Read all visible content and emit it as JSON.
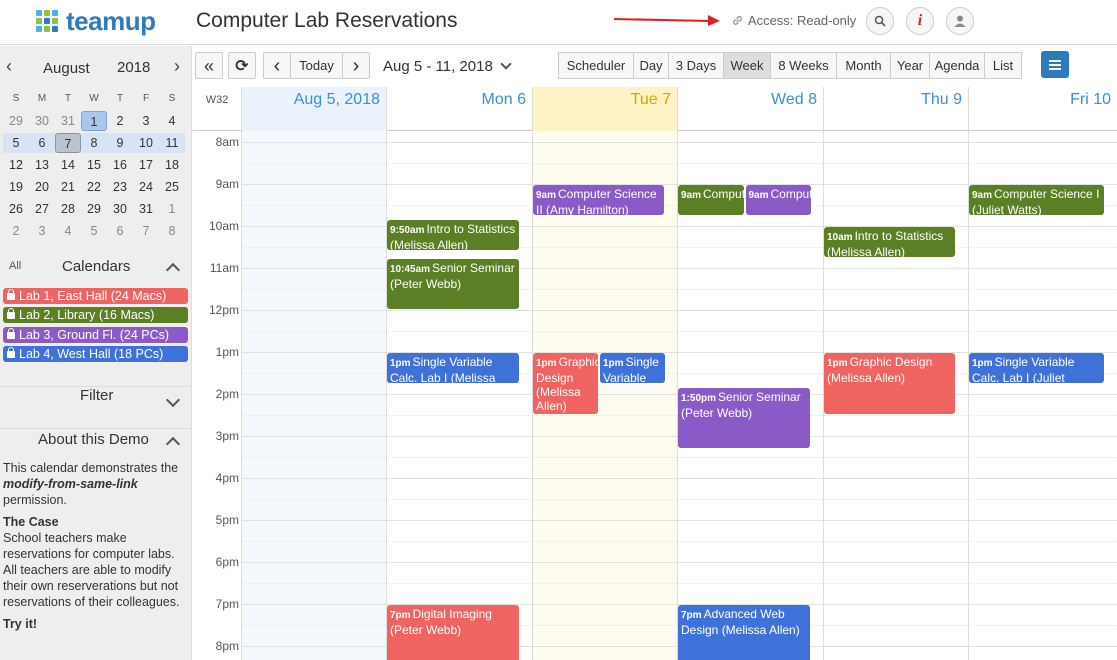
{
  "header": {
    "logo_text": "teamup",
    "title": "Computer Lab Reservations",
    "access": "Access: Read-only",
    "info_glyph": "i",
    "icons": [
      "link-icon",
      "search-icon",
      "info-icon",
      "user-icon"
    ]
  },
  "mini_calendar": {
    "month": "August",
    "year": "2018",
    "prev": "‹",
    "next": "›",
    "dow": [
      "S",
      "M",
      "T",
      "W",
      "T",
      "F",
      "S"
    ],
    "weeks": [
      [
        "29",
        "30",
        "31",
        "1",
        "2",
        "3",
        "4"
      ],
      [
        "5",
        "6",
        "7",
        "8",
        "9",
        "10",
        "11"
      ],
      [
        "12",
        "13",
        "14",
        "15",
        "16",
        "17",
        "18"
      ],
      [
        "19",
        "20",
        "21",
        "22",
        "23",
        "24",
        "25"
      ],
      [
        "26",
        "27",
        "28",
        "29",
        "30",
        "31",
        "1"
      ],
      [
        "2",
        "3",
        "4",
        "5",
        "6",
        "7",
        "8"
      ]
    ]
  },
  "calendars": {
    "all_label": "All",
    "title": "Calendars",
    "items": [
      {
        "label": "Lab 1, East Hall (24 Macs)",
        "color": "#ef6461"
      },
      {
        "label": "Lab 2, Library (16 Macs)",
        "color": "#5a7f24"
      },
      {
        "label": "Lab 3, Ground Fl. (24 PCs)",
        "color": "#8a5ac7"
      },
      {
        "label": "Lab 4, West Hall (18 PCs)",
        "color": "#3f72d9"
      }
    ]
  },
  "filter": {
    "label": "Filter"
  },
  "about": {
    "title": "About this Demo",
    "intro_prefix": "This calendar demonstrates the ",
    "intro_em": "modify-from-same-link",
    "intro_suffix": " permission.",
    "case_title": "The Case",
    "case_body": "School teachers make reservations for computer labs. All teachers are able to modify their own reserverations but not reservations of their colleagues.",
    "try_title": "Try it!"
  },
  "toolbar": {
    "double_left": "«",
    "refresh": "⟳",
    "prev": "‹",
    "today": "Today",
    "next": "›",
    "range": "Aug 5 - 11, 2018",
    "views": [
      "Scheduler",
      "Day",
      "3 Days",
      "Week",
      "8 Weeks",
      "Month",
      "Year",
      "Agenda",
      "List"
    ],
    "active_view": "Week"
  },
  "week": {
    "week_no": "W32",
    "days": [
      "Aug 5, 2018",
      "Mon 6",
      "Tue 7",
      "Wed 8",
      "Thu 9",
      "Fri 10"
    ],
    "hours": [
      "8am",
      "9am",
      "10am",
      "11am",
      "12pm",
      "1pm",
      "2pm",
      "3pm",
      "4pm",
      "5pm",
      "6pm",
      "7pm",
      "8pm"
    ]
  },
  "events": [
    {
      "day": 2,
      "time": "9am",
      "title": "Computer Science II (Amy Hamilton)",
      "color": "#8a5ac7",
      "start": 9,
      "end": 9.75,
      "col": 0,
      "cols": 1
    },
    {
      "day": 3,
      "time": "9am",
      "title": "Computer",
      "color": "#5a7f24",
      "start": 9,
      "end": 9.75,
      "col": 0,
      "cols": 2
    },
    {
      "day": 3,
      "time": "9am",
      "title": "Computer",
      "color": "#8a5ac7",
      "start": 9,
      "end": 9.75,
      "col": 1,
      "cols": 2
    },
    {
      "day": 5,
      "time": "9am",
      "title": "Computer Science I (Juliet Watts)",
      "color": "#5a7f24",
      "start": 9,
      "end": 9.75,
      "col": 0,
      "cols": 1
    },
    {
      "day": 1,
      "time": "9:50am",
      "title": "Intro to Statistics (Melissa Allen)",
      "color": "#5a7f24",
      "start": 9.83,
      "end": 10.6,
      "col": 0,
      "cols": 1
    },
    {
      "day": 4,
      "time": "10am",
      "title": "Intro to Statistics (Melissa Allen)",
      "color": "#5a7f24",
      "start": 10,
      "end": 10.75,
      "col": 0,
      "cols": 1
    },
    {
      "day": 1,
      "time": "10:45am",
      "title": "Senior Seminar (Peter Webb)",
      "color": "#5a7f24",
      "start": 10.75,
      "end": 12,
      "col": 0,
      "cols": 1
    },
    {
      "day": 1,
      "time": "1pm",
      "title": "Single Variable Calc. Lab I (Melissa",
      "color": "#3f72d9",
      "start": 13,
      "end": 13.75,
      "col": 0,
      "cols": 1
    },
    {
      "day": 2,
      "time": "1pm",
      "title": "Graphic Design (Melissa Allen)",
      "color": "#ef6461",
      "start": 13,
      "end": 14.5,
      "col": 0,
      "cols": 2
    },
    {
      "day": 2,
      "time": "1pm",
      "title": "Single Variable",
      "color": "#3f72d9",
      "start": 13,
      "end": 13.75,
      "col": 1,
      "cols": 2
    },
    {
      "day": 4,
      "time": "1pm",
      "title": "Graphic Design (Melissa Allen)",
      "color": "#ef6461",
      "start": 13,
      "end": 14.5,
      "col": 0,
      "cols": 1
    },
    {
      "day": 5,
      "time": "1pm",
      "title": "Single Variable Calc. Lab I (Juliet",
      "color": "#3f72d9",
      "start": 13,
      "end": 13.75,
      "col": 0,
      "cols": 1
    },
    {
      "day": 3,
      "time": "1:50pm",
      "title": "Senior Seminar (Peter Webb)",
      "color": "#8a5ac7",
      "start": 13.83,
      "end": 15.3,
      "col": 0,
      "cols": 1
    },
    {
      "day": 1,
      "time": "7pm",
      "title": "Digital Imaging (Peter Webb)",
      "color": "#ef6461",
      "start": 19,
      "end": 20.5,
      "col": 0,
      "cols": 1
    },
    {
      "day": 3,
      "time": "7pm",
      "title": "Advanced Web Design (Melissa Allen)",
      "color": "#3f72d9",
      "start": 19,
      "end": 20.5,
      "col": 0,
      "cols": 1
    }
  ]
}
